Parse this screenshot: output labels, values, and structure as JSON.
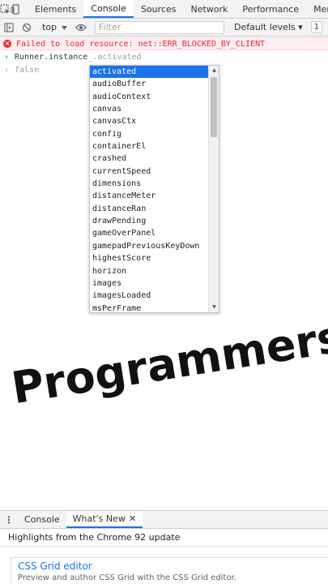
{
  "devtools": {
    "tabs": [
      "Elements",
      "Console",
      "Sources",
      "Network",
      "Performance",
      "Memor"
    ],
    "active_tab": "Console"
  },
  "toolbar": {
    "context": "top",
    "filter_placeholder": "Filter",
    "levels": "Default levels ▾",
    "issues_badge": "1"
  },
  "console": {
    "error_text": "Failed to load resource: net::ERR_BLOCKED_BY_CLIENT",
    "input_typed": "Runner.instance",
    "input_ghost": "_.activated",
    "result": "false"
  },
  "autocomplete": {
    "selected": "activated",
    "items": [
      "activated",
      "audioBuffer",
      "audioContext",
      "canvas",
      "canvasCtx",
      "config",
      "containerEl",
      "crashed",
      "currentSpeed",
      "dimensions",
      "distanceMeter",
      "distanceRan",
      "drawPending",
      "gameOverPanel",
      "gamepadPreviousKeyDown",
      "highestScore",
      "horizon",
      "images",
      "imagesLoaded",
      "msPerFrame"
    ]
  },
  "overlay_caption": "Programmers",
  "drawer": {
    "tabs": [
      "Console",
      "What's New"
    ],
    "active_tab": "What's New",
    "highlights": "Highlights from the Chrome 92 update",
    "card_title": "CSS Grid editor",
    "card_description": "Preview and author CSS Grid with the CSS Grid editor."
  },
  "colors": {
    "accent": "#1a73e8",
    "error": "#e8232f",
    "error_background": "#fff0f0",
    "toolbar_background": "#f3f3f3"
  }
}
